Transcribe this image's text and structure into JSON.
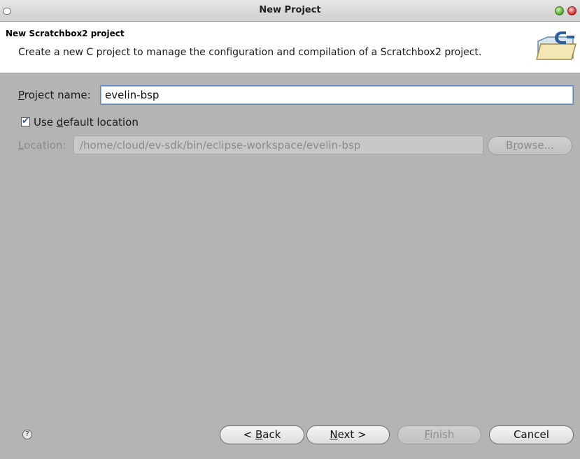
{
  "window": {
    "title": "New Project"
  },
  "header": {
    "title": "New Scratchbox2 project",
    "description": "Create a new C project to manage the configuration and compilation of a Scratchbox2 project."
  },
  "form": {
    "project_name_label_prefix": "P",
    "project_name_label_rest": "roject name:",
    "project_name_value": "evelin-bsp",
    "use_default_prefix": "Use ",
    "use_default_mnemonic": "d",
    "use_default_rest": "efault location",
    "use_default_checked": true,
    "location_label_prefix": "L",
    "location_label_rest": "ocation:",
    "location_value": "/home/cloud/ev-sdk/bin/eclipse-workspace/evelin-bsp",
    "browse_prefix": "B",
    "browse_mnemonic": "r",
    "browse_rest": "owse..."
  },
  "buttons": {
    "back_prefix": "< ",
    "back_mnemonic": "B",
    "back_rest": "ack",
    "next_mnemonic": "N",
    "next_rest": "ext >",
    "finish_mnemonic": "F",
    "finish_rest": "inish",
    "cancel": "Cancel"
  },
  "icons": {
    "help": "help-icon",
    "wizard_banner": "c-project-folder-icon"
  },
  "colors": {
    "background": "#b4b4b4",
    "header": "#ffffff",
    "focus_border": "#5b86c4"
  }
}
